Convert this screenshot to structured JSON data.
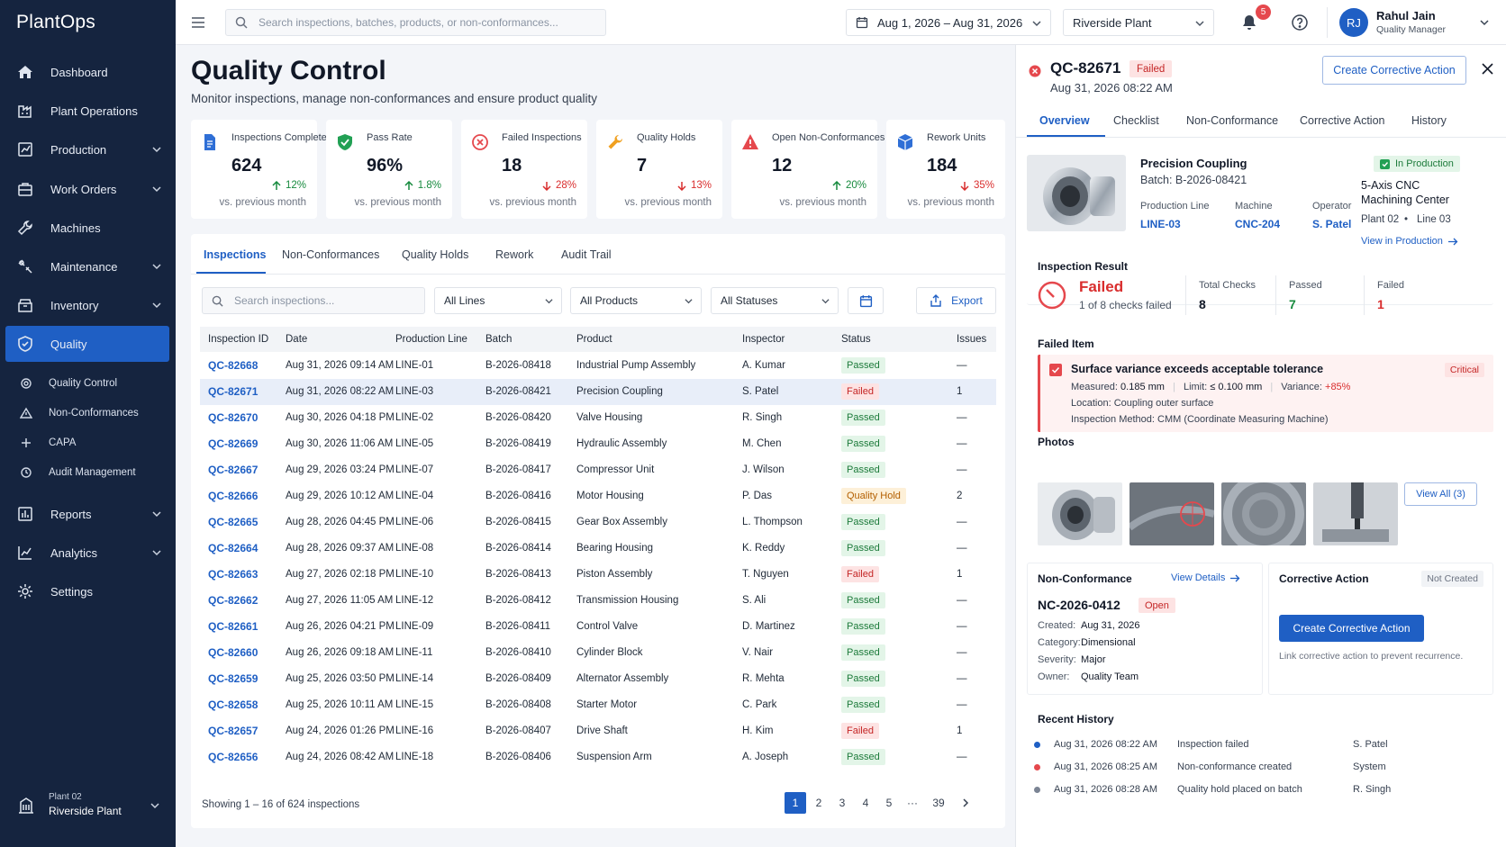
{
  "app": {
    "name": "PlantOps"
  },
  "sidebar": {
    "items": [
      {
        "label": "Dashboard",
        "icon": "home-icon"
      },
      {
        "label": "Plant Operations",
        "icon": "factory-icon"
      },
      {
        "label": "Production",
        "icon": "chart-icon"
      },
      {
        "label": "Work Orders",
        "icon": "briefcase-icon"
      },
      {
        "label": "Machines",
        "icon": "wrench-icon"
      },
      {
        "label": "Maintenance",
        "icon": "tools-icon"
      },
      {
        "label": "Inventory",
        "icon": "box-icon"
      },
      {
        "label": "Quality",
        "icon": "shield-icon"
      },
      {
        "label": "Reports",
        "icon": "report-icon"
      },
      {
        "label": "Analytics",
        "icon": "analytics-icon"
      },
      {
        "label": "Settings",
        "icon": "gear-icon"
      }
    ],
    "quality_sub": [
      {
        "label": "Quality Control",
        "icon": "target-icon"
      },
      {
        "label": "Non-Conformances",
        "icon": "warning-icon"
      },
      {
        "label": "CAPA",
        "icon": "plus-icon"
      },
      {
        "label": "Audit Management",
        "icon": "audit-icon"
      }
    ],
    "plant": {
      "line1": "Plant 02",
      "line2": "Riverside Plant"
    }
  },
  "topbar": {
    "search_placeholder": "Search inspections, batches, products, or non-conformances...",
    "date_range": "Aug 1, 2026 – Aug 31, 2026",
    "plant": "Riverside Plant",
    "notifications": "5",
    "user": {
      "initials": "RJ",
      "name": "Rahul Jain",
      "role": "Quality Manager"
    }
  },
  "page": {
    "title": "Quality Control",
    "subtitle": "Monitor inspections, manage non-conformances and ensure product quality"
  },
  "kpis": [
    {
      "label": "Inspections Completed",
      "value": "624",
      "trend": "12%",
      "dir": "up",
      "compare": "vs. previous month"
    },
    {
      "label": "Pass Rate",
      "value": "96%",
      "trend": "1.8%",
      "dir": "up",
      "compare": "vs. previous month"
    },
    {
      "label": "Failed Inspections",
      "value": "18",
      "trend": "28%",
      "dir": "down",
      "compare": "vs. previous month"
    },
    {
      "label": "Quality Holds",
      "value": "7",
      "trend": "13%",
      "dir": "down",
      "compare": "vs. previous month"
    },
    {
      "label": "Open Non-Conformances",
      "value": "12",
      "trend": "20%",
      "dir": "up",
      "compare": "vs. previous month"
    },
    {
      "label": "Rework Units",
      "value": "184",
      "trend": "35%",
      "dir": "down",
      "compare": "vs. previous month"
    }
  ],
  "tabs": [
    "Inspections",
    "Non-Conformances",
    "Quality Holds",
    "Rework",
    "Audit Trail"
  ],
  "filters": {
    "search_placeholder": "Search inspections...",
    "lines": "All Lines",
    "products": "All Products",
    "statuses": "All Statuses",
    "export": "Export"
  },
  "table": {
    "headers": [
      "Inspection ID",
      "Date",
      "Production Line",
      "Batch",
      "Product",
      "Inspector",
      "Status",
      "Issues"
    ],
    "rows": [
      {
        "id": "QC-82668",
        "date": "Aug 31, 2026 09:14 AM",
        "line": "LINE-01",
        "batch": "B-2026-08418",
        "product": "Industrial Pump Assembly",
        "inspector": "A. Kumar",
        "status": "Passed",
        "issues": "—"
      },
      {
        "id": "QC-82671",
        "date": "Aug 31, 2026 08:22 AM",
        "line": "LINE-03",
        "batch": "B-2026-08421",
        "product": "Precision Coupling",
        "inspector": "S. Patel",
        "status": "Failed",
        "issues": "1"
      },
      {
        "id": "QC-82670",
        "date": "Aug 30, 2026 04:18 PM",
        "line": "LINE-02",
        "batch": "B-2026-08420",
        "product": "Valve Housing",
        "inspector": "R. Singh",
        "status": "Passed",
        "issues": "—"
      },
      {
        "id": "QC-82669",
        "date": "Aug 30, 2026 11:06 AM",
        "line": "LINE-05",
        "batch": "B-2026-08419",
        "product": "Hydraulic Assembly",
        "inspector": "M. Chen",
        "status": "Passed",
        "issues": "—"
      },
      {
        "id": "QC-82667",
        "date": "Aug 29, 2026 03:24 PM",
        "line": "LINE-07",
        "batch": "B-2026-08417",
        "product": "Compressor Unit",
        "inspector": "J. Wilson",
        "status": "Passed",
        "issues": "—"
      },
      {
        "id": "QC-82666",
        "date": "Aug 29, 2026 10:12 AM",
        "line": "LINE-04",
        "batch": "B-2026-08416",
        "product": "Motor Housing",
        "inspector": "P. Das",
        "status": "Quality Hold",
        "issues": "2"
      },
      {
        "id": "QC-82665",
        "date": "Aug 28, 2026 04:45 PM",
        "line": "LINE-06",
        "batch": "B-2026-08415",
        "product": "Gear Box Assembly",
        "inspector": "L. Thompson",
        "status": "Passed",
        "issues": "—"
      },
      {
        "id": "QC-82664",
        "date": "Aug 28, 2026 09:37 AM",
        "line": "LINE-08",
        "batch": "B-2026-08414",
        "product": "Bearing Housing",
        "inspector": "K. Reddy",
        "status": "Passed",
        "issues": "—"
      },
      {
        "id": "QC-82663",
        "date": "Aug 27, 2026 02:18 PM",
        "line": "LINE-10",
        "batch": "B-2026-08413",
        "product": "Piston Assembly",
        "inspector": "T. Nguyen",
        "status": "Failed",
        "issues": "1"
      },
      {
        "id": "QC-82662",
        "date": "Aug 27, 2026 11:05 AM",
        "line": "LINE-12",
        "batch": "B-2026-08412",
        "product": "Transmission Housing",
        "inspector": "S. Ali",
        "status": "Passed",
        "issues": "—"
      },
      {
        "id": "QC-82661",
        "date": "Aug 26, 2026 04:21 PM",
        "line": "LINE-09",
        "batch": "B-2026-08411",
        "product": "Control Valve",
        "inspector": "D. Martinez",
        "status": "Passed",
        "issues": "—"
      },
      {
        "id": "QC-82660",
        "date": "Aug 26, 2026 09:18 AM",
        "line": "LINE-11",
        "batch": "B-2026-08410",
        "product": "Cylinder Block",
        "inspector": "V. Nair",
        "status": "Passed",
        "issues": "—"
      },
      {
        "id": "QC-82659",
        "date": "Aug 25, 2026 03:50 PM",
        "line": "LINE-14",
        "batch": "B-2026-08409",
        "product": "Alternator Assembly",
        "inspector": "R. Mehta",
        "status": "Passed",
        "issues": "—"
      },
      {
        "id": "QC-82658",
        "date": "Aug 25, 2026 10:11 AM",
        "line": "LINE-15",
        "batch": "B-2026-08408",
        "product": "Starter Motor",
        "inspector": "C. Park",
        "status": "Passed",
        "issues": "—"
      },
      {
        "id": "QC-82657",
        "date": "Aug 24, 2026 01:26 PM",
        "line": "LINE-16",
        "batch": "B-2026-08407",
        "product": "Drive Shaft",
        "inspector": "H. Kim",
        "status": "Failed",
        "issues": "1"
      },
      {
        "id": "QC-82656",
        "date": "Aug 24, 2026 08:42 AM",
        "line": "LINE-18",
        "batch": "B-2026-08406",
        "product": "Suspension Arm",
        "inspector": "A. Joseph",
        "status": "Passed",
        "issues": "—"
      }
    ],
    "showing": "Showing 1 – 16 of 624 inspections",
    "pages": [
      "1",
      "2",
      "3",
      "4",
      "5",
      "···",
      "39"
    ]
  },
  "detail": {
    "id": "QC-82671",
    "status": "Failed",
    "date": "Aug 31, 2026 08:22 AM",
    "create_btn": "Create Corrective Action",
    "tabs": [
      "Overview",
      "Checklist",
      "Non-Conformance",
      "Corrective Action",
      "History"
    ],
    "product": {
      "name": "Precision Coupling",
      "batch": "Batch: B-2026-08421",
      "line_label": "Production Line",
      "line": "LINE-03",
      "machine_label": "Machine",
      "machine": "CNC-204",
      "operator_label": "Operator",
      "operator": "S. Patel",
      "state": "In Production",
      "center1": "5-Axis CNC",
      "center2": "Machining Center",
      "plant": "Plant 02",
      "line_short": "Line 03",
      "view_link": "View in Production"
    },
    "result": {
      "title": "Inspection Result",
      "status": "Failed",
      "summary": "1 of 8 checks failed",
      "total_label": "Total Checks",
      "total": "8",
      "passed_label": "Passed",
      "passed": "7",
      "failed_label": "Failed",
      "failed": "1"
    },
    "failed_item": {
      "title": "Failed Item",
      "name": "Surface variance exceeds acceptable tolerance",
      "severity": "Critical",
      "measured_label": "Measured:",
      "measured": "0.185 mm",
      "limit_label": "Limit:",
      "limit": "≤ 0.100 mm",
      "variance_label": "Variance:",
      "variance": "+85%",
      "location": "Location: Coupling outer surface",
      "method": "Inspection Method: CMM (Coordinate Measuring Machine)"
    },
    "photos": {
      "title": "Photos",
      "view_all": "View All (3)"
    },
    "nc": {
      "title": "Non-Conformance",
      "view_details": "View Details",
      "id": "NC-2026-0412",
      "status": "Open",
      "created_label": "Created:",
      "created": "Aug 31, 2026",
      "category_label": "Category:",
      "category": "Dimensional",
      "severity_label": "Severity:",
      "severity": "Major",
      "owner_label": "Owner:",
      "owner": "Quality Team"
    },
    "ca": {
      "title": "Corrective Action",
      "status": "Not Created",
      "button": "Create Corrective Action",
      "hint": "Link corrective action to prevent recurrence."
    },
    "history": {
      "title": "Recent History",
      "items": [
        {
          "time": "Aug 31, 2026 08:22 AM",
          "event": "Inspection failed",
          "user": "S. Patel",
          "color": "#1f5fc4"
        },
        {
          "time": "Aug 31, 2026 08:25 AM",
          "event": "Non-conformance created",
          "user": "System",
          "color": "#e5484d"
        },
        {
          "time": "Aug 31, 2026 08:28 AM",
          "event": "Quality hold placed on batch",
          "user": "R. Singh",
          "color": "#7b8494"
        }
      ]
    }
  },
  "colors": {
    "brand": "#1f5fc4",
    "sidebar": "#15243f",
    "passed": "#1c7a3a",
    "failed": "#c42626",
    "hold": "#b35f00"
  }
}
